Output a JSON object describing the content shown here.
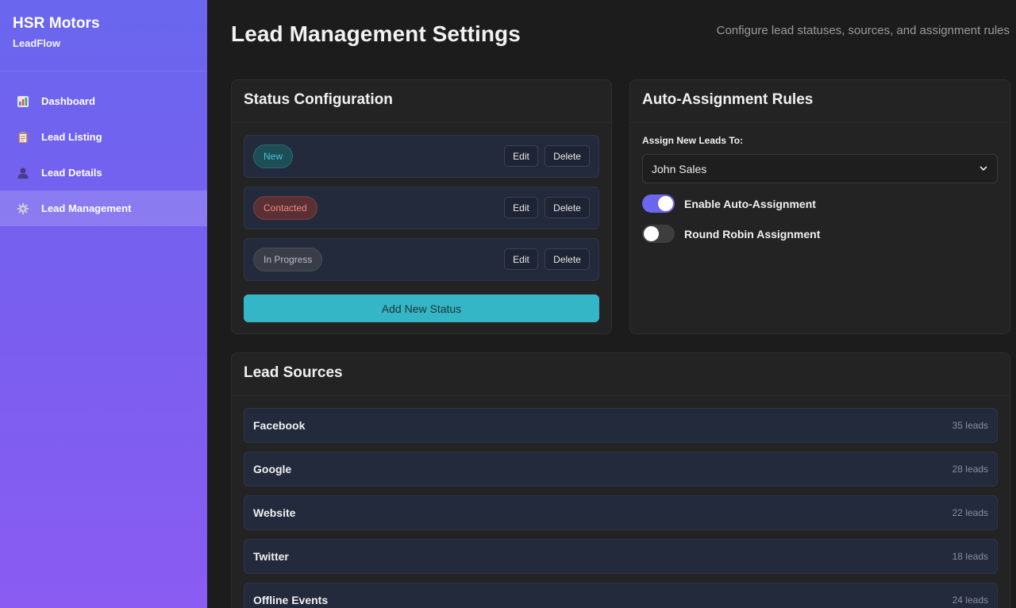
{
  "sidebar": {
    "brand_title": "HSR Motors",
    "brand_sub": "LeadFlow",
    "items": [
      {
        "label": "Dashboard",
        "icon": "bar-chart-icon"
      },
      {
        "label": "Lead Listing",
        "icon": "clipboard-icon"
      },
      {
        "label": "Lead Details",
        "icon": "person-icon"
      },
      {
        "label": "Lead Management",
        "icon": "gear-icon",
        "active": true
      }
    ]
  },
  "header": {
    "title": "Lead Management Settings",
    "description": "Configure lead statuses, sources, and assignment rules"
  },
  "status_config": {
    "title": "Status Configuration",
    "statuses": [
      {
        "label": "New",
        "color": "#46c7d6"
      },
      {
        "label": "Contacted",
        "color": "#f08a7a"
      },
      {
        "label": "In Progress",
        "color": "#b8bcc8"
      }
    ],
    "edit_label": "Edit",
    "delete_label": "Delete",
    "add_label": "Add New Status"
  },
  "assignment": {
    "title": "Auto-Assignment Rules",
    "field_label": "Assign New Leads To:",
    "selected_value": "John Sales",
    "toggles": [
      {
        "label": "Enable Auto-Assignment",
        "on": true
      },
      {
        "label": "Round Robin Assignment",
        "on": false
      }
    ]
  },
  "sources": {
    "title": "Lead Sources",
    "items": [
      {
        "name": "Facebook",
        "count": "35 leads"
      },
      {
        "name": "Google",
        "count": "28 leads"
      },
      {
        "name": "Website",
        "count": "22 leads"
      },
      {
        "name": "Twitter",
        "count": "18 leads"
      },
      {
        "name": "Offline Events",
        "count": "24 leads"
      }
    ]
  },
  "colors": {
    "accent": "#6a66ee",
    "add_button": "#35b6c6"
  }
}
